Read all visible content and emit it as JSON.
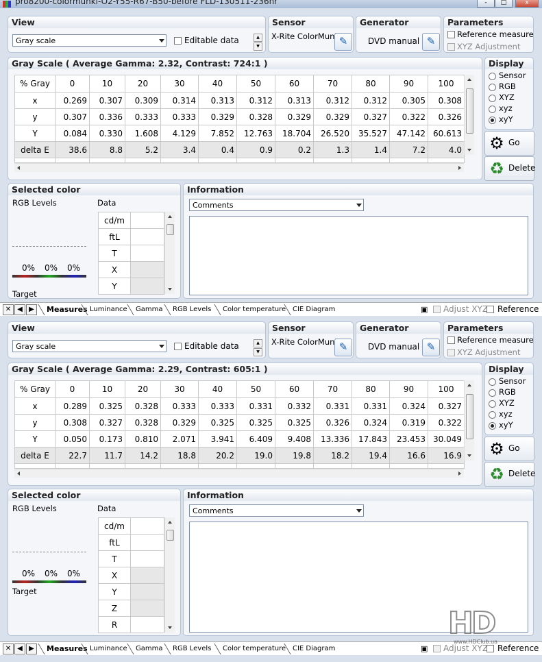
{
  "window": {
    "title": "pro8200-colormunki-O2-Y55-R67-B50-before FLD-130511-236nr",
    "min": "-",
    "max": "□",
    "close": "x"
  },
  "instances": [
    {
      "view": {
        "header": "View",
        "dropdown_value": "Gray scale",
        "editable_label": "Editable data"
      },
      "sensor": {
        "header": "Sensor",
        "value": "X-Rite ColorMunki"
      },
      "generator": {
        "header": "Generator",
        "value": "DVD manual"
      },
      "parameters": {
        "header": "Parameters",
        "reference_measure": "Reference measure",
        "xyz_adjustment": "XYZ Adjustment"
      },
      "grayscale": {
        "header": "Gray Scale ( Average Gamma: 2.32, Contrast: 724:1 )",
        "row_label_header": "% Gray",
        "columns": [
          "0",
          "10",
          "20",
          "30",
          "40",
          "50",
          "60",
          "70",
          "80",
          "90",
          "100"
        ],
        "rows": [
          {
            "label": "x",
            "values": [
              "0.269",
              "0.307",
              "0.309",
              "0.314",
              "0.313",
              "0.312",
              "0.313",
              "0.312",
              "0.312",
              "0.305",
              "0.308"
            ]
          },
          {
            "label": "y",
            "values": [
              "0.307",
              "0.336",
              "0.333",
              "0.333",
              "0.329",
              "0.328",
              "0.329",
              "0.329",
              "0.327",
              "0.322",
              "0.326"
            ]
          },
          {
            "label": "Y",
            "values": [
              "0.084",
              "0.330",
              "1.608",
              "4.129",
              "7.852",
              "12.763",
              "18.704",
              "26.520",
              "35.527",
              "47.142",
              "60.613"
            ]
          },
          {
            "label": "delta E",
            "values": [
              "38.6",
              "8.8",
              "5.2",
              "3.4",
              "0.4",
              "0.9",
              "0.2",
              "1.3",
              "1.4",
              "7.2",
              "4.0"
            ]
          }
        ]
      },
      "display": {
        "header": "Display",
        "options": [
          "Sensor",
          "RGB",
          "XYZ",
          "xyz",
          "xyY"
        ],
        "selected": "xyY"
      },
      "go_label": "Go",
      "delete_label": "Delete",
      "selected_color": {
        "header": "Selected color",
        "rgb_levels": "RGB Levels",
        "data_label": "Data",
        "pcts": [
          "0%",
          "0%",
          "0%"
        ],
        "target": "Target",
        "data_rows": [
          "cd/m",
          "ftL",
          "T",
          "X",
          "Y"
        ]
      },
      "information": {
        "header": "Information",
        "comments_value": "Comments"
      },
      "tabs": [
        "Measures",
        "Luminance",
        "Gamma",
        "RGB Levels",
        "Color temperature",
        "CIE Diagram"
      ],
      "footer": {
        "adjust_xyz": "Adjust XYZ",
        "reference": "Reference"
      }
    },
    {
      "view": {
        "header": "View",
        "dropdown_value": "Gray scale",
        "editable_label": "Editable data"
      },
      "sensor": {
        "header": "Sensor",
        "value": "X-Rite ColorMunki"
      },
      "generator": {
        "header": "Generator",
        "value": "DVD manual"
      },
      "parameters": {
        "header": "Parameters",
        "reference_measure": "Reference measure",
        "xyz_adjustment": "XYZ Adjustment"
      },
      "grayscale": {
        "header": "Gray Scale ( Average Gamma: 2.29, Contrast: 605:1 )",
        "row_label_header": "% Gray",
        "columns": [
          "0",
          "10",
          "20",
          "30",
          "40",
          "50",
          "60",
          "70",
          "80",
          "90",
          "100"
        ],
        "rows": [
          {
            "label": "x",
            "values": [
              "0.289",
              "0.325",
              "0.328",
              "0.333",
              "0.333",
              "0.331",
              "0.332",
              "0.331",
              "0.331",
              "0.324",
              "0.327"
            ]
          },
          {
            "label": "y",
            "values": [
              "0.308",
              "0.327",
              "0.328",
              "0.329",
              "0.325",
              "0.325",
              "0.325",
              "0.326",
              "0.324",
              "0.319",
              "0.322"
            ]
          },
          {
            "label": "Y",
            "values": [
              "0.050",
              "0.173",
              "0.810",
              "2.071",
              "3.941",
              "6.409",
              "9.408",
              "13.336",
              "17.843",
              "23.453",
              "30.049"
            ]
          },
          {
            "label": "delta E",
            "values": [
              "22.7",
              "11.7",
              "14.2",
              "18.8",
              "20.2",
              "19.0",
              "19.8",
              "18.2",
              "19.4",
              "16.6",
              "16.9"
            ]
          }
        ]
      },
      "display": {
        "header": "Display",
        "options": [
          "Sensor",
          "RGB",
          "XYZ",
          "xyz",
          "xyY"
        ],
        "selected": "xyY"
      },
      "go_label": "Go",
      "delete_label": "Delete",
      "selected_color": {
        "header": "Selected color",
        "rgb_levels": "RGB Levels",
        "data_label": "Data",
        "pcts": [
          "0%",
          "0%",
          "0%"
        ],
        "target": "Target",
        "data_rows": [
          "cd/m",
          "ftL",
          "T",
          "X",
          "Y",
          "Z",
          "R"
        ]
      },
      "information": {
        "header": "Information",
        "comments_value": "Comments"
      },
      "tabs": [
        "Measures",
        "Luminance",
        "Gamma",
        "RGB Levels",
        "Color temperature",
        "CIE Diagram"
      ],
      "footer": {
        "adjust_xyz": "Adjust XYZ",
        "reference": "Reference"
      }
    }
  ],
  "watermark": {
    "logo": "HD",
    "url": "www.HDClub.ua"
  }
}
